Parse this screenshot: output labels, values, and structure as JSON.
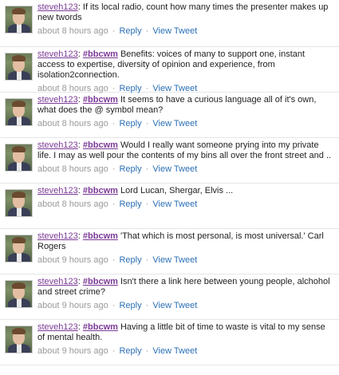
{
  "tweets": [
    {
      "user": "steveh123",
      "hashtag": "",
      "text": " If its local radio, count how many times the presenter makes up new twords",
      "time": "about 8 hours ago",
      "reply_label": "Reply",
      "view_label": "View Tweet"
    },
    {
      "user": "steveh123",
      "hashtag": "#bbcwm",
      "text": " Benefits: voices of many to support one, instant access to expertise, diversity of opinion and experience, from isolation2connection.",
      "time": "about 8 hours ago",
      "reply_label": "Reply",
      "view_label": "View Tweet"
    },
    {
      "user": "steveh123",
      "hashtag": "#bbcwm",
      "text": " It seems to have a curious language all of it's own, what does the @ symbol mean?",
      "time": "about 8 hours ago",
      "reply_label": "Reply",
      "view_label": "View Tweet"
    },
    {
      "user": "steveh123",
      "hashtag": "#bbcwm",
      "text": " Would I really want someone prying into my private life. I may as well pour the contents of my bins all over the front street and ..",
      "time": "about 8 hours ago",
      "reply_label": "Reply",
      "view_label": "View Tweet"
    },
    {
      "user": "steveh123",
      "hashtag": "#bbcwm",
      "text": " Lord Lucan, Shergar, Elvis ...",
      "time": "about 8 hours ago",
      "reply_label": "Reply",
      "view_label": "View Tweet"
    },
    {
      "user": "steveh123",
      "hashtag": "#bbcwm",
      "text": " 'That which is most personal, is most universal.' Carl Rogers",
      "time": "about 9 hours ago",
      "reply_label": "Reply",
      "view_label": "View Tweet"
    },
    {
      "user": "steveh123",
      "hashtag": "#bbcwm",
      "text": " Isn't there a link here between young people, alchohol and street crime?",
      "time": "about 9 hours ago",
      "reply_label": "Reply",
      "view_label": "View Tweet"
    },
    {
      "user": "steveh123",
      "hashtag": "#bbcwm",
      "text": " Having a little bit of time to waste is vital to my sense of mental health.",
      "time": "about 9 hours ago",
      "reply_label": "Reply",
      "view_label": "View Tweet"
    }
  ],
  "separators": {
    "user_colon": ":",
    "meta_dot": "·"
  },
  "colors": {
    "link_purple": "#7b3a96",
    "link_blue": "#2b6fb6",
    "meta_grey": "#999999"
  }
}
